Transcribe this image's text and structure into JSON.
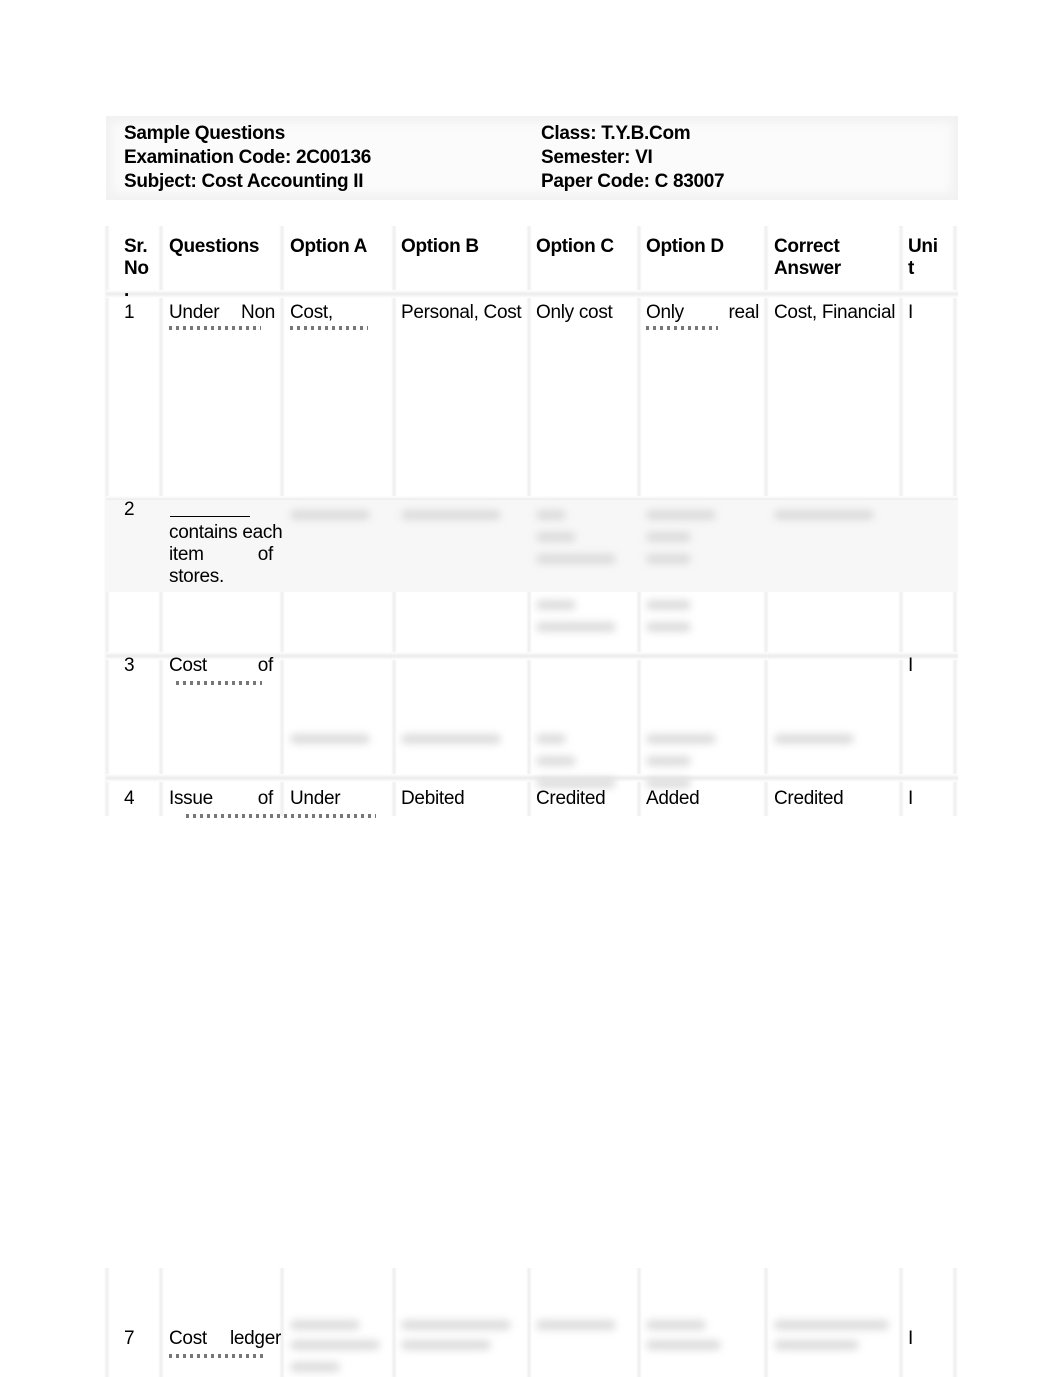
{
  "header": {
    "left": {
      "title": "Sample Questions",
      "exam_code": "Examination Code: 2C00136",
      "subject": "Subject: Cost Accounting II"
    },
    "right": {
      "class": "Class: T.Y.B.Com",
      "semester": "Semester: VI",
      "paper_code": "Paper Code: C 83007"
    }
  },
  "table": {
    "columns": {
      "sr_no": [
        "Sr.",
        "No",
        "."
      ],
      "question": "Questions",
      "option_a": "Option A",
      "option_b": "Option B",
      "option_c": "Option C",
      "option_d": "Option D",
      "correct": [
        "Correct",
        "Answer"
      ],
      "unit": [
        "Uni",
        "t"
      ]
    },
    "rows": [
      {
        "sr": "1",
        "question": [
          "Under",
          "Non"
        ],
        "option_a": "Cost,",
        "option_b": "Personal, Cost",
        "option_c": "Only cost",
        "option_d": [
          "Only",
          "real"
        ],
        "correct": "Cost, Financial",
        "unit": "I"
      },
      {
        "sr": "2",
        "question_blank": "________",
        "question": [
          "contains each",
          "item",
          "of",
          "stores."
        ],
        "unit": ""
      },
      {
        "sr": "3",
        "question": [
          "Cost",
          "of"
        ],
        "unit": "I"
      },
      {
        "sr": "4",
        "question": [
          "Issue",
          "of"
        ],
        "option_a": "Under",
        "option_b": "Debited",
        "option_c": "Credited",
        "option_d": "Added",
        "correct": "Credited",
        "unit": "I"
      },
      {
        "sr": "7",
        "question": [
          "Cost",
          "ledger"
        ],
        "unit": "I"
      }
    ]
  }
}
